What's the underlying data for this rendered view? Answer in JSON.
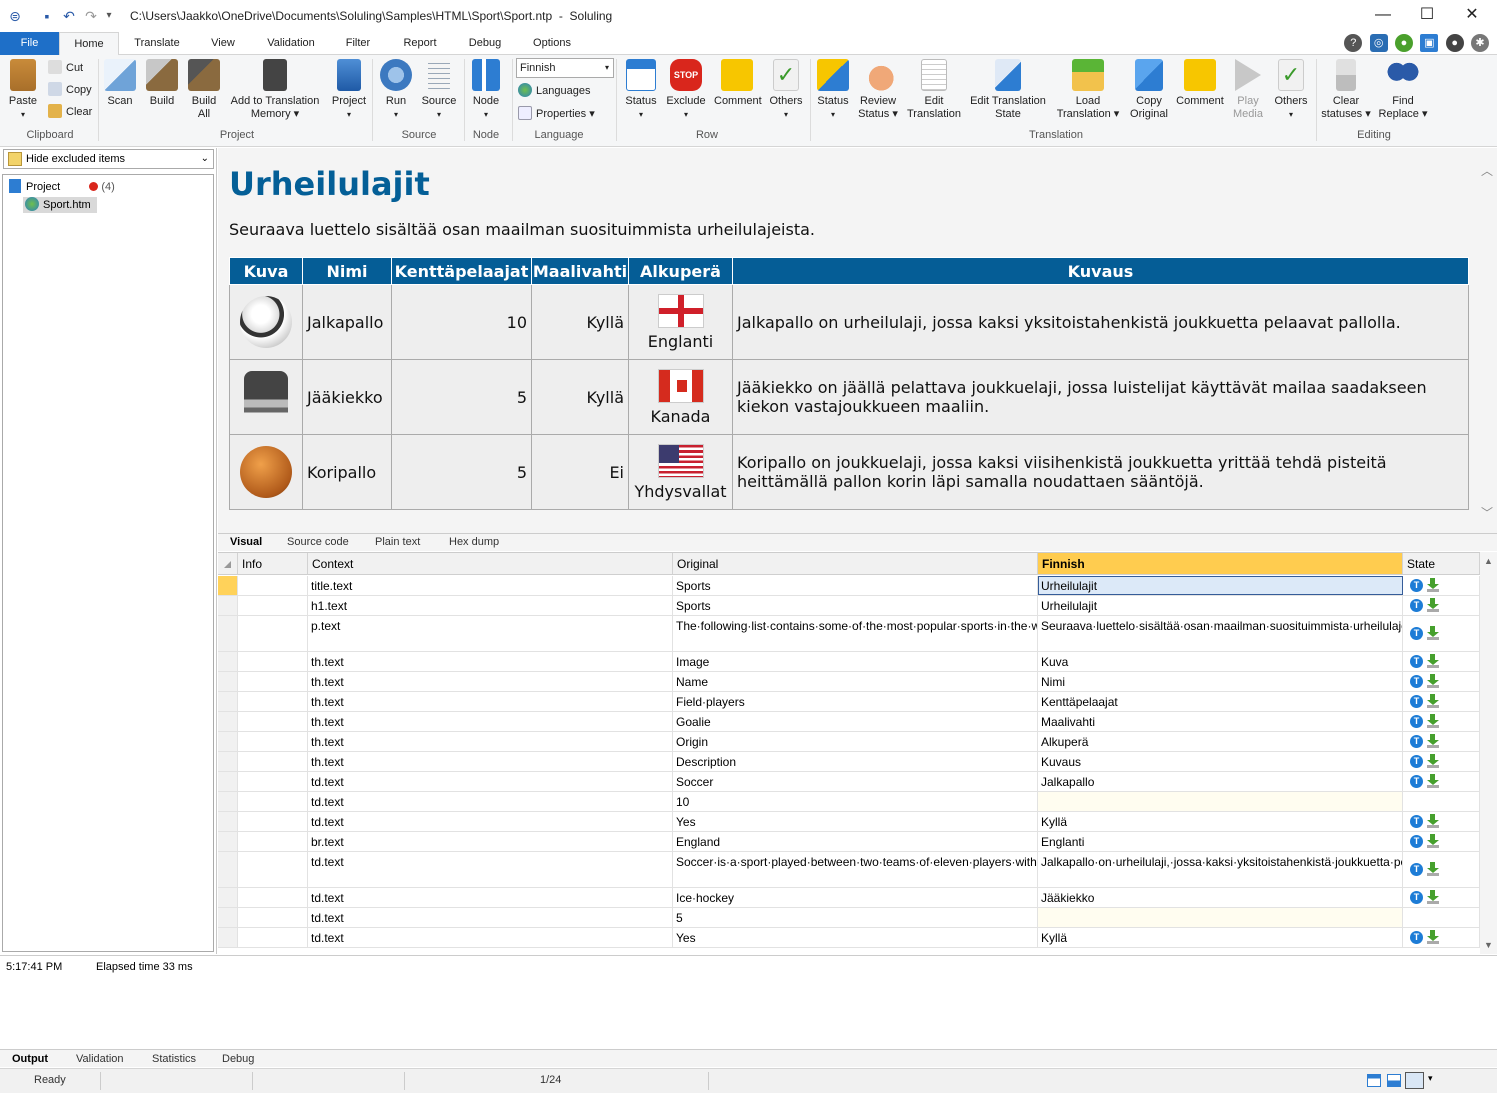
{
  "window": {
    "path": "C:\\Users\\Jaakko\\OneDrive\\Documents\\Soluling\\Samples\\HTML\\Sport\\Sport.ntp",
    "app": "Soluling"
  },
  "menu": {
    "tabs": [
      "File",
      "Home",
      "Translate",
      "View",
      "Validation",
      "Filter",
      "Report",
      "Debug",
      "Options"
    ]
  },
  "ribbon": {
    "paste": "Paste",
    "cut": "Cut",
    "copy": "Copy",
    "clear": "Clear",
    "scan": "Scan",
    "build": "Build",
    "build_all_1": "Build",
    "build_all_2": "All",
    "add_tm_1": "Add to Translation",
    "add_tm_2": "Memory",
    "project": "Project",
    "run": "Run",
    "source": "Source",
    "node": "Node",
    "language_value": "Finnish",
    "languages": "Languages",
    "properties": "Properties",
    "status": "Status",
    "exclude": "Exclude",
    "comment": "Comment",
    "others": "Others",
    "status2": "Status",
    "review_1": "Review",
    "review_2": "Status",
    "edit_1": "Edit",
    "edit_2": "Translation",
    "edit_state_1": "Edit Translation",
    "edit_state_2": "State",
    "load_1": "Load",
    "load_2": "Translation",
    "copy_orig_1": "Copy",
    "copy_orig_2": "Original",
    "comment2": "Comment",
    "play_1": "Play",
    "play_2": "Media",
    "others2": "Others",
    "clear_st_1": "Clear",
    "clear_st_2": "statuses",
    "find_1": "Find",
    "find_2": "Replace",
    "groups": {
      "clipboard": "Clipboard",
      "project": "Project",
      "source": "Source",
      "node": "Node",
      "language": "Language",
      "row": "Row",
      "translation": "Translation",
      "editing": "Editing"
    }
  },
  "leftpane": {
    "filter": "Hide excluded items",
    "project": "Project",
    "count": "(4)",
    "file": "Sport.htm"
  },
  "preview": {
    "title": "Urheilulajit",
    "lead": "Seuraava luettelo sisältää osan maailman suosituimmista urheilulajeista.",
    "headers": [
      "Kuva",
      "Nimi",
      "Kenttäpelaajat",
      "Maalivahti",
      "Alkuperä",
      "Kuvaus"
    ],
    "rows": [
      {
        "name": "Jalkapallo",
        "players": "10",
        "goalie": "Kyllä",
        "origin": "Englanti",
        "desc": "Jalkapallo on urheilulaji, jossa kaksi yksitoistahenkistä joukkuetta pelaavat pallolla."
      },
      {
        "name": "Jääkiekko",
        "players": "5",
        "goalie": "Kyllä",
        "origin": "Kanada",
        "desc": "Jääkiekko on jäällä pelattava joukkuelaji, jossa luistelijat käyttävät mailaa saadakseen kiekon vastajoukkueen maaliin."
      },
      {
        "name": "Koripallo",
        "players": "5",
        "goalie": "Ei",
        "origin": "Yhdysvallat",
        "desc": "Koripallo on joukkuelaji, jossa kaksi viisihenkistä joukkuetta yrittää tehdä pisteitä heittämällä pallon korin läpi samalla noudattaen sääntöjä."
      }
    ]
  },
  "viewtabs": [
    "Visual",
    "Source code",
    "Plain text",
    "Hex dump"
  ],
  "grid": {
    "headers": {
      "info": "Info",
      "context": "Context",
      "original": "Original",
      "finnish": "Finnish",
      "state": "State"
    },
    "rows": [
      {
        "context": "title.text",
        "original": "Sports",
        "finnish": "Urheilulajit"
      },
      {
        "context": "h1.text",
        "original": "Sports",
        "finnish": "Urheilulajit"
      },
      {
        "context": "p.text",
        "original": "The·following·list·contains·some·of·the·most·popular·sports·in·the·world.",
        "finnish": "Seuraava·luettelo·sisältää·osan·maailman·suosituimmista·urheilulajeista."
      },
      {
        "context": "th.text",
        "original": "Image",
        "finnish": "Kuva"
      },
      {
        "context": "th.text",
        "original": "Name",
        "finnish": "Nimi"
      },
      {
        "context": "th.text",
        "original": "Field·players",
        "finnish": "Kenttäpelaajat"
      },
      {
        "context": "th.text",
        "original": "Goalie",
        "finnish": "Maalivahti"
      },
      {
        "context": "th.text",
        "original": "Origin",
        "finnish": "Alkuperä"
      },
      {
        "context": "th.text",
        "original": "Description",
        "finnish": "Kuvaus"
      },
      {
        "context": "td.text",
        "original": "Soccer",
        "finnish": "Jalkapallo"
      },
      {
        "context": "td.text",
        "original": "10",
        "finnish": ""
      },
      {
        "context": "td.text",
        "original": "Yes",
        "finnish": "Kyllä"
      },
      {
        "context": "br.text",
        "original": "England",
        "finnish": "Englanti"
      },
      {
        "context": "td.text",
        "original": "Soccer·is·a·sport·played·between·two·teams·of·eleven·players·with·a·spherical·ball.",
        "finnish": "Jalkapallo·on·urheilulaji,·jossa·kaksi·yksitoistahenkistä·joukkuetta·pelaavat·pallolla."
      },
      {
        "context": "td.text",
        "original": "Ice·hockey",
        "finnish": "Jääkiekko"
      },
      {
        "context": "td.text",
        "original": "5",
        "finnish": ""
      },
      {
        "context": "td.text",
        "original": "Yes",
        "finnish": "Kyllä"
      }
    ]
  },
  "output": {
    "time": "5:17:41 PM",
    "elapsed": "Elapsed time 33 ms"
  },
  "outtabs": [
    "Output",
    "Validation",
    "Statistics",
    "Debug"
  ],
  "status": {
    "ready": "Ready",
    "page": "1/24"
  }
}
